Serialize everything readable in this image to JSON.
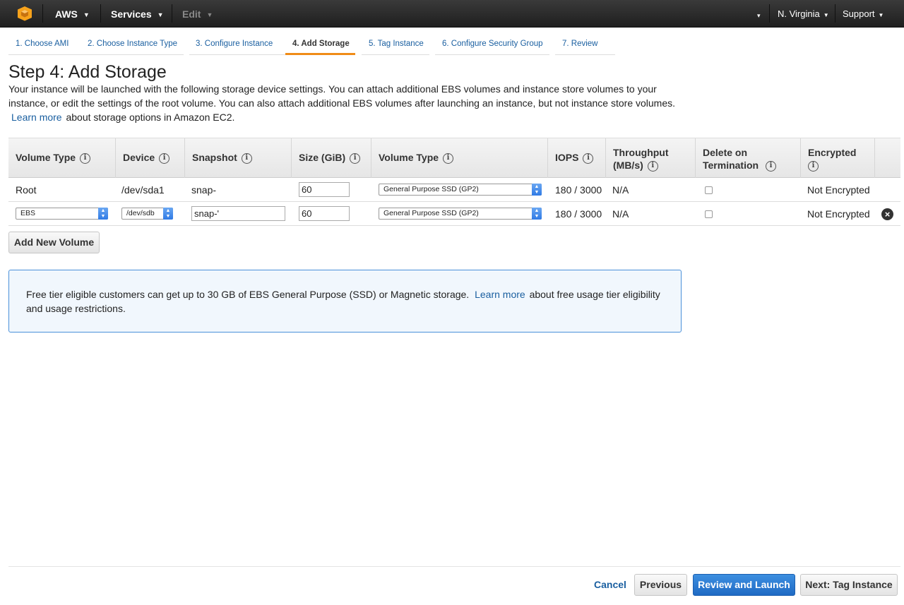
{
  "topbar": {
    "brand": "AWS",
    "services": "Services",
    "edit": "Edit",
    "user_caret": "▾",
    "region": "N. Virginia",
    "support": "Support"
  },
  "tabs": [
    {
      "label": "1. Choose AMI"
    },
    {
      "label": "2. Choose Instance Type"
    },
    {
      "label": "3. Configure Instance"
    },
    {
      "label": "4. Add Storage"
    },
    {
      "label": "5. Tag Instance"
    },
    {
      "label": "6. Configure Security Group"
    },
    {
      "label": "7. Review"
    }
  ],
  "page": {
    "title": "Step 4: Add Storage",
    "intro": "Your instance will be launched with the following storage device settings. You can attach additional EBS volumes and instance store volumes to your instance, or edit the settings of the root volume. You can also attach additional EBS volumes after launching an instance, but not instance store volumes.",
    "learn_more": "Learn more",
    "intro_tail": "about storage options in Amazon EC2."
  },
  "table": {
    "headers": {
      "volume_type": "Volume Type",
      "device": "Device",
      "snapshot": "Snapshot",
      "size": "Size (GiB)",
      "volume_type2": "Volume Type",
      "iops": "IOPS",
      "throughput_1": "Throughput",
      "throughput_2": "(MB/s)",
      "delete_1": "Delete on",
      "delete_2": "Termination",
      "encrypted": "Encrypted"
    },
    "rows": [
      {
        "volume_type": "Root",
        "device": "/dev/sda1",
        "snapshot": "snap-",
        "size": "60",
        "ebs_type": "General Purpose SSD (GP2)",
        "iops": "180 / 3000",
        "throughput": "N/A",
        "delete_on_termination": false,
        "encrypted": "Not Encrypted"
      },
      {
        "volume_type": "EBS",
        "device": "/dev/sdb",
        "snapshot": "snap-'",
        "size": "60",
        "ebs_type": "General Purpose SSD (GP2)",
        "iops": "180 / 3000",
        "throughput": "N/A",
        "delete_on_termination": false,
        "encrypted": "Not Encrypted"
      }
    ]
  },
  "add_volume_label": "Add New Volume",
  "notice": {
    "text": "Free tier eligible customers can get up to 30 GB of EBS General Purpose (SSD) or Magnetic storage.",
    "learn_more": "Learn more",
    "tail": "about free usage tier eligibility and usage restrictions."
  },
  "footer": {
    "cancel": "Cancel",
    "previous": "Previous",
    "review_launch": "Review and Launch",
    "next": "Next: Tag Instance"
  },
  "colors": {
    "accent": "#f08c17",
    "link": "#1a5fa0",
    "primary_button": "#1f6ac4",
    "notice_bg": "#f1f7fd"
  }
}
